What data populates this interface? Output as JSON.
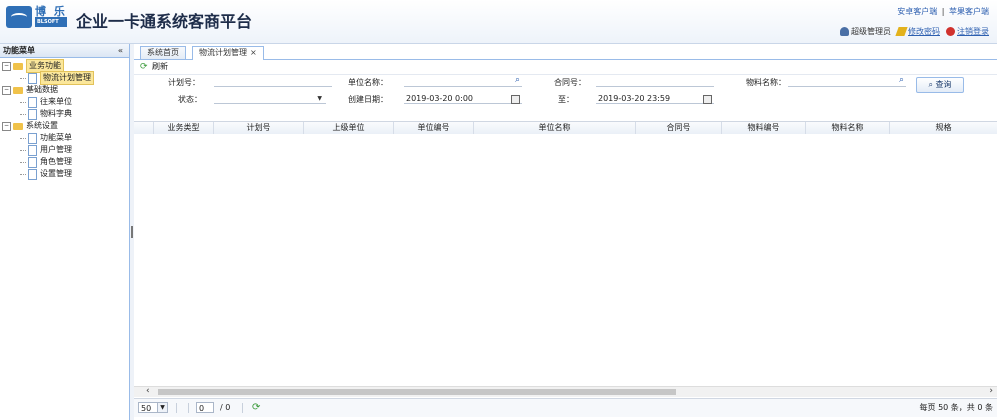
{
  "header": {
    "logo_cn": "博 乐",
    "logo_en": "BLSOFT",
    "title": "企业一卡通系统客商平台",
    "link_android": "安卓客户端",
    "link_separator": "|",
    "link_apple": "苹果客户端",
    "user_name": "超级管理员",
    "change_password": "修改密码",
    "logout": "注销登录"
  },
  "sidebar": {
    "title": "功能菜单",
    "collapse": "«",
    "groups": [
      {
        "label": "业务功能",
        "items": [
          {
            "label": "物流计划管理"
          }
        ]
      },
      {
        "label": "基础数据",
        "items": [
          {
            "label": "往来单位"
          },
          {
            "label": "物料字典"
          }
        ]
      },
      {
        "label": "系统设置",
        "items": [
          {
            "label": "功能菜单"
          },
          {
            "label": "用户管理"
          },
          {
            "label": "角色管理"
          },
          {
            "label": "设置管理"
          }
        ]
      }
    ]
  },
  "tabs": [
    {
      "label": "系统首页"
    },
    {
      "label": "物流计划管理",
      "close": "×"
    }
  ],
  "toolbar": {
    "refresh": "刷新"
  },
  "form": {
    "plan_no": "计划号：",
    "unit_name": "单位名称：",
    "contract_no": "合同号：",
    "material_name": "物料名称：",
    "status": "状态：",
    "created_date": "创建日期：",
    "date_from": "2019-03-20 0:00",
    "to": "至：",
    "date_to": "2019-03-20 23:59",
    "query": "查询"
  },
  "grid": {
    "columns": [
      "业务类型",
      "计划号",
      "上级单位",
      "单位编号",
      "单位名称",
      "合同号",
      "物料编号",
      "物料名称",
      "规格"
    ]
  },
  "pager": {
    "page_size": "50",
    "current_page": "0",
    "total_pages": "/ 0",
    "info": "每页 50 条，共 0 条"
  }
}
